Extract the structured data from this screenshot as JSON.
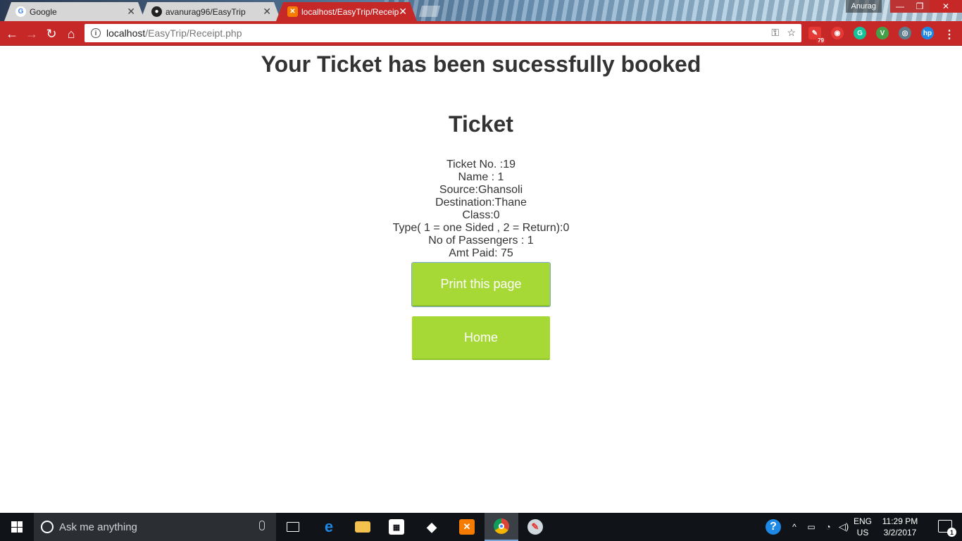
{
  "browser": {
    "tabs": [
      {
        "label": "Google",
        "icon": "google-favicon"
      },
      {
        "label": "avanurag96/EasyTrip",
        "icon": "github-favicon"
      },
      {
        "label": "localhost/EasyTrip/Receipt.php",
        "icon": "xampp-favicon",
        "active": true
      }
    ],
    "profile_name": "Anurag",
    "address": {
      "host": "localhost",
      "path": "/EasyTrip/Receipt.php"
    },
    "extension_badge": "79",
    "accent_color": "#c62828"
  },
  "page": {
    "heading": "Your Ticket has been sucessfully booked",
    "subheading": "Ticket",
    "details": [
      "Ticket No. :19",
      "Name : 1",
      "Source:Ghansoli",
      "Destination:Thane",
      "Class:0",
      "Type( 1 = one Sided , 2 = Return):0",
      "No of Passengers : 1",
      "Amt Paid: 75"
    ],
    "print_button": "Print this page",
    "home_button": "Home",
    "button_color": "#a6d935"
  },
  "taskbar": {
    "search_placeholder": "Ask me anything",
    "lang_line1": "ENG",
    "lang_line2": "US",
    "time": "11:29 PM",
    "date": "3/2/2017",
    "notification_count": "1"
  }
}
